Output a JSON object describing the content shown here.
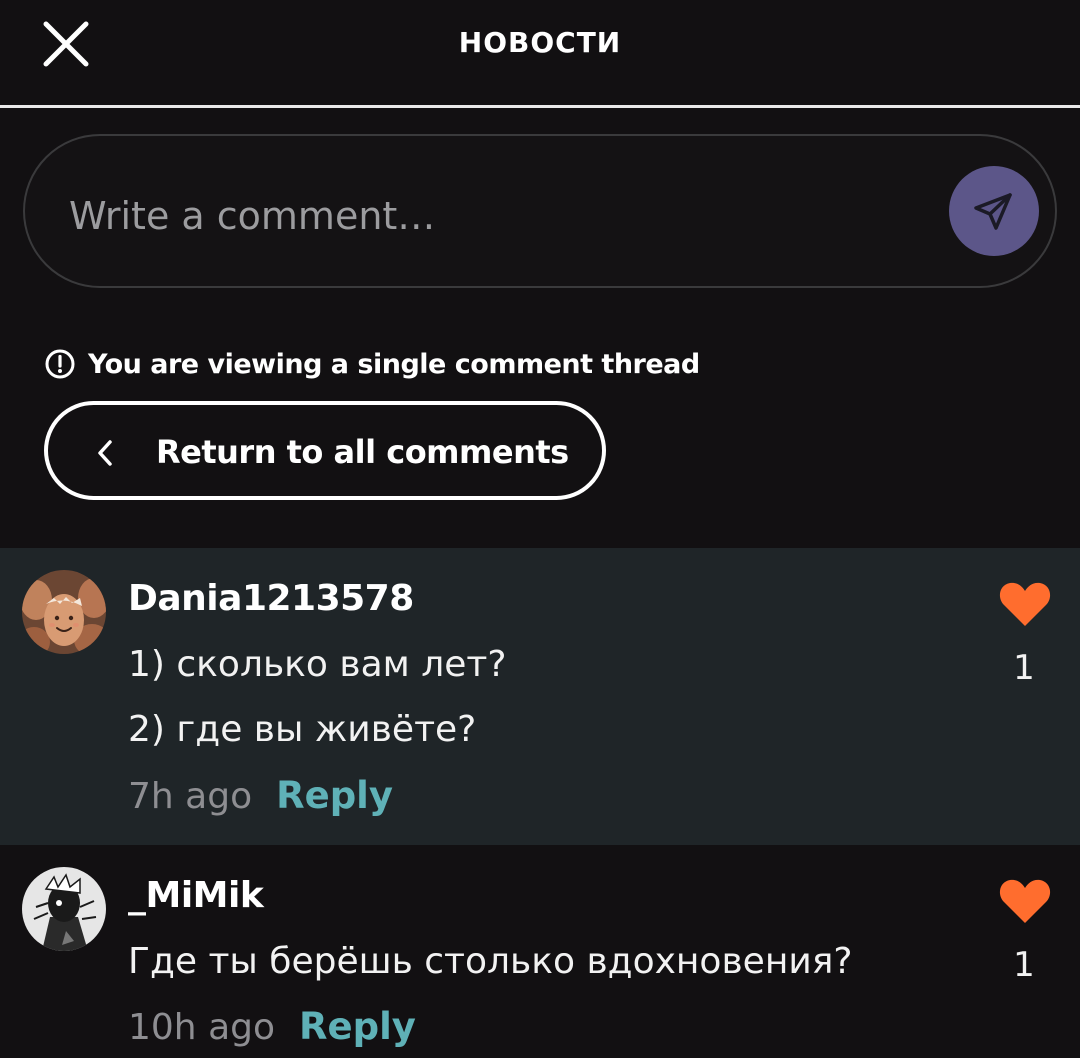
{
  "header": {
    "title": "НОВОСТИ"
  },
  "composer": {
    "placeholder": "Write a comment…"
  },
  "thread_notice": {
    "text": "You are viewing a single comment thread"
  },
  "return_button": {
    "label": "Return to all comments"
  },
  "comments": [
    {
      "username": "Dania1213578",
      "lines": [
        "1) сколько вам лет?",
        "2) где вы живёте?"
      ],
      "time": "7h ago",
      "reply_label": "Reply",
      "likes": "1",
      "liked": true,
      "highlighted": true
    },
    {
      "username": "_MiMik",
      "lines": [
        "Где ты берёшь столько вдохновения?"
      ],
      "time": "10h ago",
      "reply_label": "Reply",
      "likes": "1",
      "liked": true,
      "highlighted": false
    }
  ],
  "colors": {
    "background": "#121012",
    "highlight_background": "#1f2528",
    "send_button": "#5c5689",
    "reply_link": "#5fb1b7",
    "heart": "#ff6d2e",
    "muted_text": "#8e8e92"
  },
  "icons": {
    "close": "close-icon",
    "send": "paper-plane-icon",
    "info": "info-circle-icon",
    "back": "chevron-left-icon",
    "like": "heart-icon"
  }
}
